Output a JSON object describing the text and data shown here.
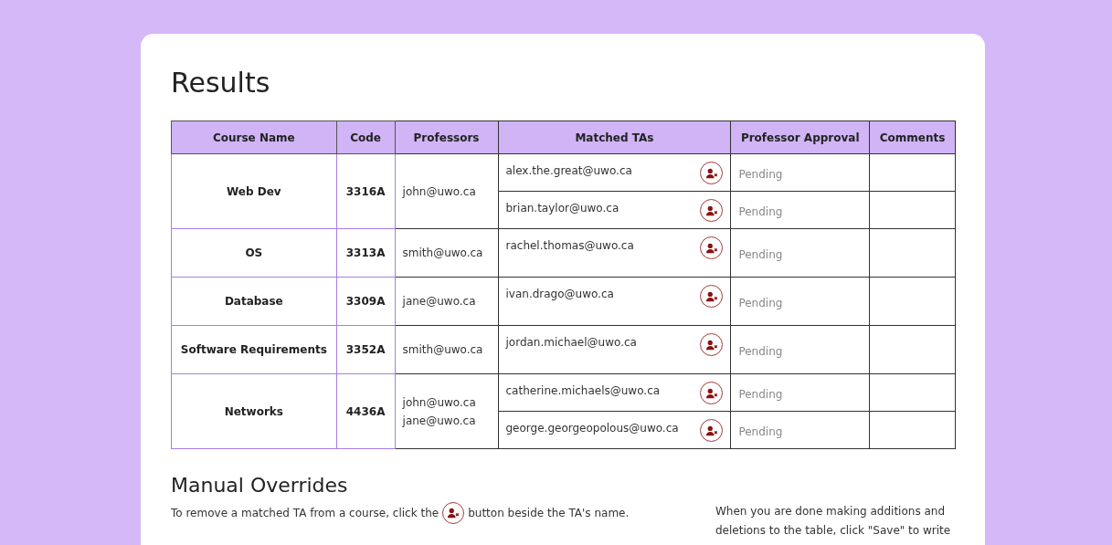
{
  "title": "Results",
  "table": {
    "columns": [
      "Course Name",
      "Code",
      "Professors",
      "Matched TAs",
      "Professor Approval",
      "Comments"
    ],
    "rows": [
      {
        "course_name": "Web Dev",
        "code": "3316A",
        "professors": [
          "john@uwo.ca"
        ],
        "tas": [
          {
            "email": "alex.the.great@uwo.ca",
            "approval": "Pending"
          },
          {
            "email": "brian.taylor@uwo.ca",
            "approval": "Pending"
          }
        ]
      },
      {
        "course_name": "OS",
        "code": "3313A",
        "professors": [
          "smith@uwo.ca"
        ],
        "tas": [
          {
            "email": "rachel.thomas@uwo.ca",
            "approval": "Pending"
          }
        ]
      },
      {
        "course_name": "Database",
        "code": "3309A",
        "professors": [
          "jane@uwo.ca"
        ],
        "tas": [
          {
            "email": "ivan.drago@uwo.ca",
            "approval": "Pending"
          }
        ]
      },
      {
        "course_name": "Software Requirements",
        "code": "3352A",
        "professors": [
          "smith@uwo.ca"
        ],
        "tas": [
          {
            "email": "jordan.michael@uwo.ca",
            "approval": "Pending"
          }
        ]
      },
      {
        "course_name": "Networks",
        "code": "4436A",
        "professors": [
          "john@uwo.ca",
          "jane@uwo.ca"
        ],
        "tas": [
          {
            "email": "catherine.michaels@uwo.ca",
            "approval": "Pending"
          },
          {
            "email": "george.georgeopolous@uwo.ca",
            "approval": "Pending"
          }
        ]
      }
    ]
  },
  "manual_overrides": {
    "heading": "Manual Overrides",
    "instruction": {
      "before": "To remove a matched TA from a course, click the",
      "after": "button beside the TA's name."
    },
    "side_note": "When you are done making additions and deletions to the table, click \"Save\" to write"
  }
}
